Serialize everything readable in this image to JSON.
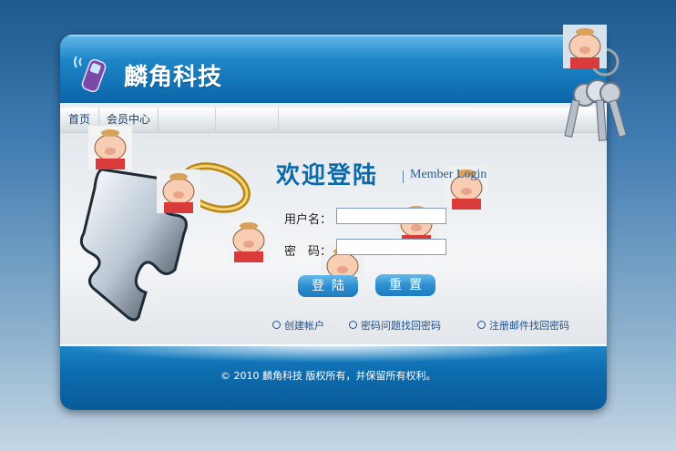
{
  "header": {
    "logo_icon": "mobile-phone-icon",
    "brand": "麟角科技"
  },
  "nav": {
    "items": [
      {
        "label": "首页"
      },
      {
        "label": "会员中心"
      }
    ]
  },
  "login": {
    "title": "欢迎登陆",
    "subtitle": "Member Login",
    "username_label": "用户名：",
    "password_label": "密　码：",
    "username_value": "",
    "password_value": "",
    "login_button": "登陆",
    "reset_button": "重置"
  },
  "links": {
    "create_account": "创建帐户",
    "question_recover": "密码问题找回密码",
    "email_recover": "注册邮件找回密码"
  },
  "footer": {
    "copyright": "© 2010 麟角科技 版权所有，并保留所有权利。"
  },
  "colors": {
    "accent": "#0d6aa8",
    "header_blue": "#1d86c7",
    "button_blue": "#2f8fcf"
  },
  "decorations": [
    "puzzle-piece-icon",
    "gold-ring-icon",
    "keys-icon",
    "pig-avatar-icon"
  ]
}
